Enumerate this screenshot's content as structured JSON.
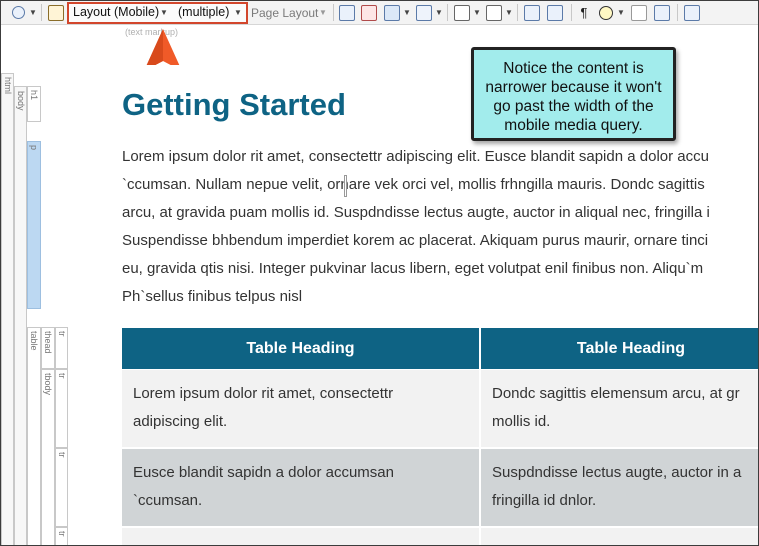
{
  "toolbar": {
    "layout_label": "Layout (Mobile)",
    "medium_label": "(multiple)",
    "page_layout_label": "Page Layout",
    "text_markup_hint": "(text markup)",
    "icons": [
      "zoom-icon",
      "spell-check-icon",
      "insert-icon",
      "image-icon",
      "table-icon",
      "variable-icon",
      "snippet-icon",
      "text-icon",
      "condition-icon",
      "concept-icon",
      "paragraph-mark-icon",
      "highlight-icon",
      "copy-icon",
      "duplicate-icon",
      "insert-link-icon"
    ]
  },
  "structure": {
    "html_label": "html",
    "body_label": "body",
    "h1_label": "h1",
    "p_label": "p",
    "table_label": "table",
    "thead_label": "thead",
    "tbody_label": "tbody",
    "tr_label": "tr"
  },
  "callout": {
    "text": "Notice the content is narrower because it won't go past the width of the mobile media query."
  },
  "document": {
    "heading": "Getting Started",
    "paragraph_lines": [
      "Lorem ipsum dolor rit amet, consectettr adipiscing elit. Eusce blandit sapidn a dolor accu",
      "`ccumsan. Nullam nepue velit, ornare vek orci vel, mollis frhngilla mauris. Dondc sagittis",
      "arcu, at gravida puam mollis id. Suspdndisse lectus augte, auctor in aliqual nec, fringilla i",
      "Suspendisse bhbendum imperdiet korem ac placerat. Akiquam purus maurir, ornare tinci",
      "eu, gravida qtis nisi. Integer pukvinar lacus libern, eget volutpat enil finibus non. Aliqu`m",
      "Ph`sellus finibus telpus nisl"
    ],
    "table": {
      "headers": [
        "Table Heading",
        "Table Heading"
      ],
      "rows": [
        [
          "Lorem ipsum dolor rit amet, consectettr\nadipiscing elit.",
          "Dondc sagittis elemensum arcu, at gr\nmollis id."
        ],
        [
          "Eusce blandit sapidn a dolor accumsan\n`ccumsan.",
          "Suspdndisse lectus augte, auctor in a\nfringilla id dnlor."
        ]
      ]
    }
  },
  "colors": {
    "heading": "#0e6384",
    "table_header_bg": "#0e6384",
    "callout_bg": "#a2ecec",
    "highlight_border": "#d2462c",
    "arrow": "#f05a28"
  }
}
